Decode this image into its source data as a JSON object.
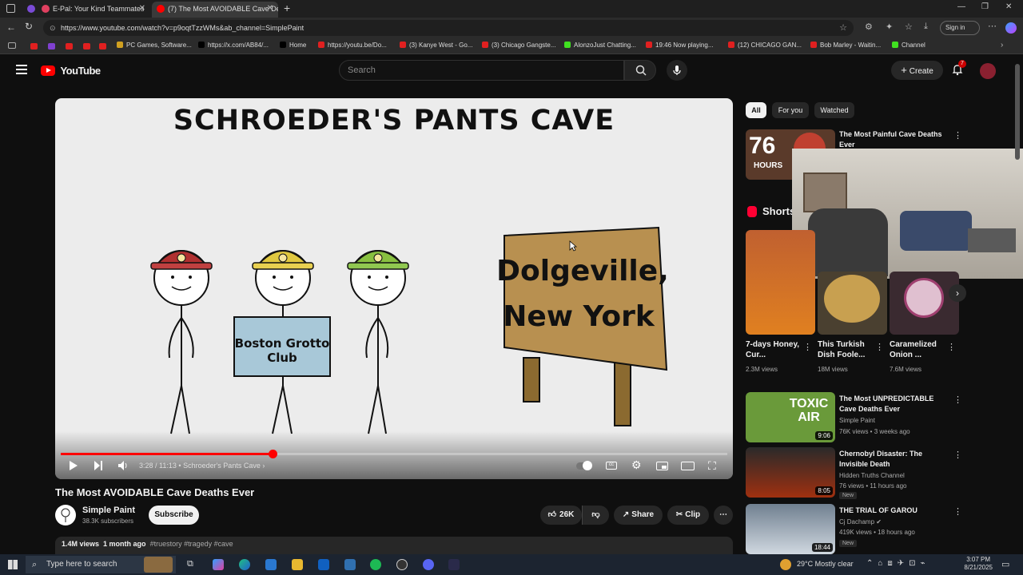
{
  "browser": {
    "tabs": [
      {
        "label": "E-Pal: Your Kind Teammates"
      },
      {
        "label": "(7) The Most AVOIDABLE Cave De"
      }
    ],
    "url": "https://www.youtube.com/watch?v=p9oqtTzzWMs&ab_channel=SimplePaint",
    "sign_in": "Sign in",
    "bookmarks": [
      "PC Games, Software...",
      "https://x.com/AB84/...",
      "Home",
      "https://youtu.be/Do...",
      "(3) Kanye West - Go...",
      "(3) Chicago Gangste...",
      "AlonzoJust Chatting...",
      "19:46 Now playing...",
      "(12) CHICAGO GAN...",
      "Bob Marley - Waitin...",
      "Channel"
    ]
  },
  "youtube": {
    "logo": "YouTube",
    "search_placeholder": "Search",
    "create_label": "Create",
    "notif_count": "7"
  },
  "video": {
    "art_title": "SCHROEDER'S PANTS CAVE",
    "sign_text_1": "Dolgeville,",
    "sign_text_2": "New York",
    "box_text_1": "Boston Grotto",
    "box_text_2": "Club",
    "current_time": "3:28",
    "duration": "11:13",
    "chapter": "Schroeder's Pants Cave",
    "progress": 0.318,
    "title": "The Most AVOIDABLE Cave Deaths Ever",
    "channel": "Simple Paint",
    "subscribers": "38.3K subscribers",
    "subscribe_label": "Subscribe",
    "likes": "26K",
    "share_label": "Share",
    "clip_label": "Clip",
    "views": "1.4M views",
    "posted": "1 month ago",
    "hashtags": "#truestory #tragedy #cave"
  },
  "sidebar": {
    "chips": [
      "All",
      "For you",
      "Watched"
    ],
    "top_video": {
      "title": "The Most Painful Cave Deaths Ever",
      "thumb_text_big": "76",
      "thumb_text_small": "HOURS"
    },
    "shorts_label": "Shorts",
    "shorts": [
      {
        "title": "7-days Honey, Cur...",
        "views": "2.3M views"
      },
      {
        "title": "This Turkish Dish Foole...",
        "views": "18M views"
      },
      {
        "title": "Caramelized Onion ...",
        "views": "7.6M views"
      }
    ],
    "videos": [
      {
        "title": "The Most UNPREDICTABLE Cave Deaths Ever",
        "channel": "Simple Paint",
        "meta": "76K views • 3 weeks ago",
        "duration": "9:06",
        "thumb_text": "TOXIC AIR"
      },
      {
        "title": "Chernobyl Disaster: The Invisible Death",
        "channel": "Hidden Truths Channel",
        "meta": "76 views • 11 hours ago",
        "duration": "8:05",
        "badge": "New"
      },
      {
        "title": "THE TRIAL OF GAROU",
        "channel": "Cj Dachamp",
        "meta": "419K views • 18 hours ago",
        "duration": "18:44",
        "badge": "New"
      }
    ]
  },
  "taskbar": {
    "search_placeholder": "Type here to search",
    "weather": "29°C  Mostly clear",
    "time": "3:07 PM",
    "date": "8/21/2025"
  },
  "colors": {
    "accent": "#ff0000",
    "bg": "#0f0f0f",
    "chip": "#272727"
  }
}
